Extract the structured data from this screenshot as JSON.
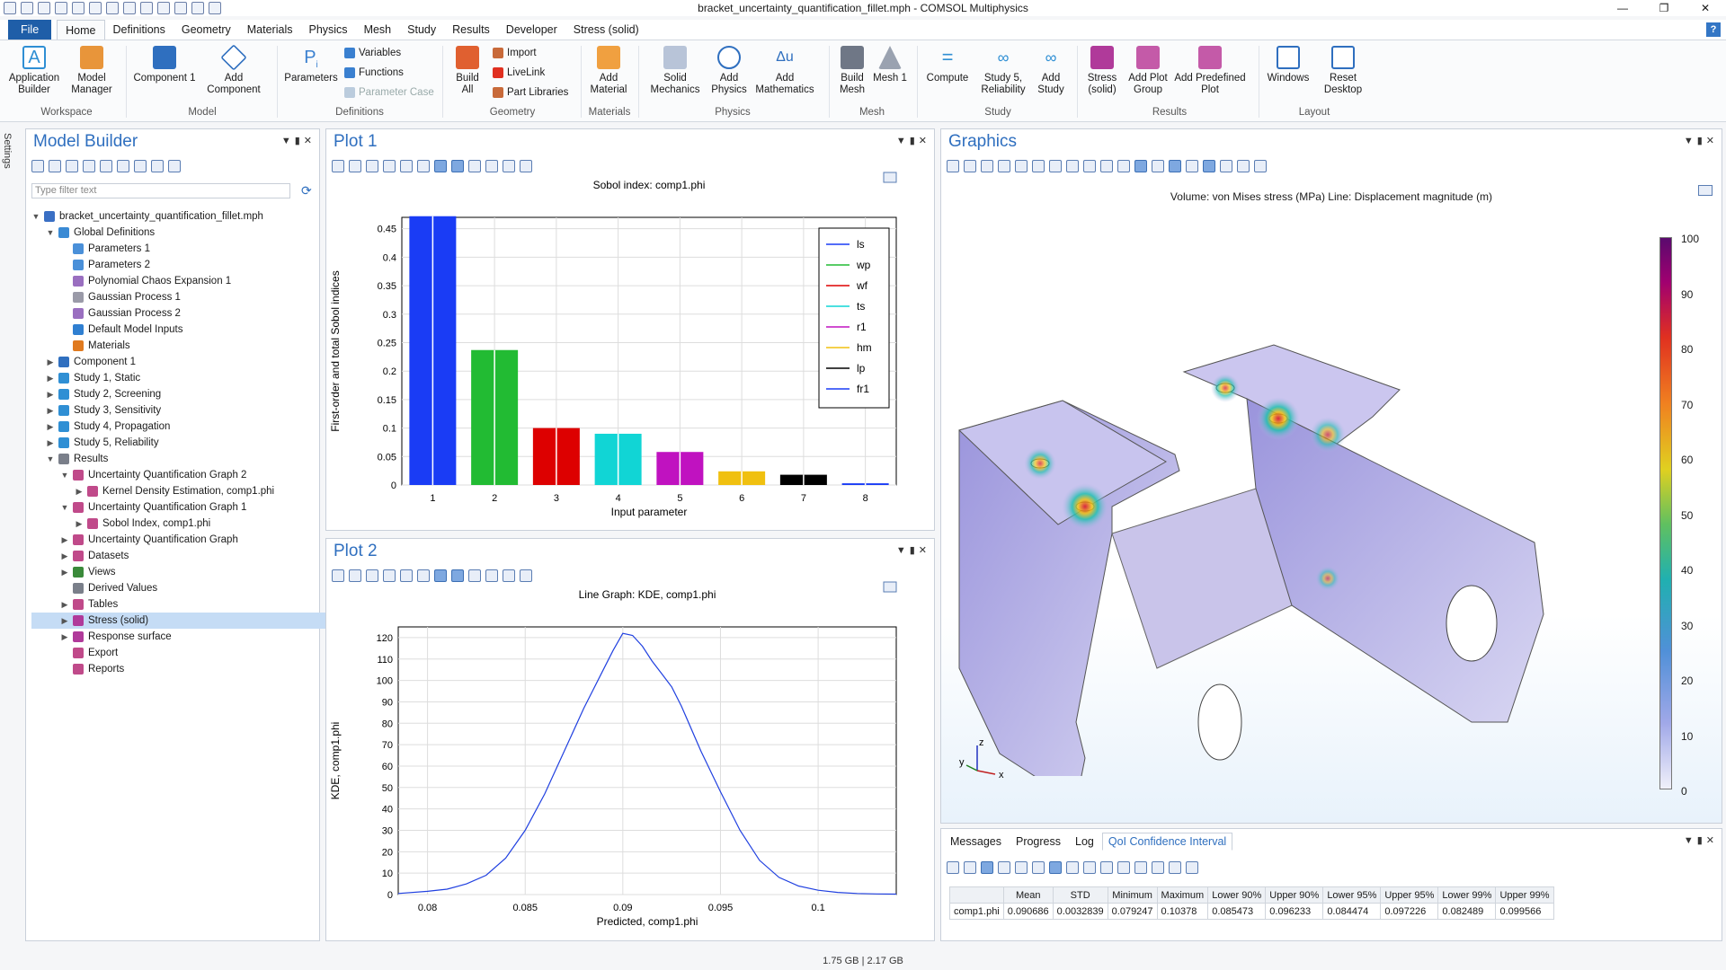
{
  "window": {
    "title": "bracket_uncertainty_quantification_fillet.mph - COMSOL Multiphysics"
  },
  "menu": {
    "file": "File",
    "items": [
      "Home",
      "Definitions",
      "Geometry",
      "Materials",
      "Physics",
      "Mesh",
      "Study",
      "Results",
      "Developer",
      "Stress (solid)"
    ]
  },
  "ribbon": {
    "buttons": {
      "app_builder": "Application Builder",
      "model_manager": "Model Manager",
      "component": "Component 1",
      "add_component": "Add Component",
      "parameters": "Parameters",
      "variables": "Variables",
      "functions": "Functions",
      "parameter_case": "Parameter Case",
      "build_all": "Build All",
      "import": "Import",
      "livelink": "LiveLink",
      "part_libraries": "Part Libraries",
      "add_material": "Add Material",
      "solid_mechanics": "Solid Mechanics",
      "add_physics": "Add Physics",
      "add_mathematics": "Add Mathematics",
      "build_mesh": "Build Mesh",
      "mesh": "Mesh 1",
      "compute": "Compute",
      "study5": "Study 5, Reliability",
      "add_study": "Add Study",
      "stress": "Stress (solid)",
      "add_plot_group": "Add Plot Group",
      "add_predefined_plot": "Add Predefined Plot",
      "windows": "Windows",
      "reset_desktop": "Reset Desktop"
    },
    "groups": {
      "workspace": "Workspace",
      "model": "Model",
      "definitions": "Definitions",
      "geometry": "Geometry",
      "materials": "Materials",
      "physics": "Physics",
      "mesh": "Mesh",
      "study": "Study",
      "results": "Results",
      "layout": "Layout"
    }
  },
  "settings_tab": "Settings",
  "model_builder": {
    "title": "Model Builder",
    "filter_placeholder": "Type filter text",
    "tree": [
      {
        "label": "bracket_uncertainty_quantification_fillet.mph",
        "icon": "file-icon",
        "color": "#3a6fc4"
      },
      {
        "label": "Global Definitions",
        "icon": "globe-icon",
        "color": "#3a8ad4"
      },
      {
        "label": "Parameters 1",
        "icon": "parameter-icon",
        "color": "#4a90d9"
      },
      {
        "label": "Parameters 2",
        "icon": "parameter-icon",
        "color": "#4a90d9"
      },
      {
        "label": "Polynomial Chaos Expansion 1",
        "icon": "surrogate-icon",
        "color": "#9a6fc0"
      },
      {
        "label": "Gaussian Process 1",
        "icon": "surrogate-icon",
        "color": "#9a9aa8"
      },
      {
        "label": "Gaussian Process 2",
        "icon": "surrogate-icon",
        "color": "#9a6fc0"
      },
      {
        "label": "Default Model Inputs",
        "icon": "model-inputs-icon",
        "color": "#2f7fd1"
      },
      {
        "label": "Materials",
        "icon": "materials-icon",
        "color": "#e07a1f"
      },
      {
        "label": "Component 1",
        "icon": "component-icon",
        "color": "#2f6fbf"
      },
      {
        "label": "Study 1, Static",
        "icon": "study-icon",
        "color": "#2f8fd4"
      },
      {
        "label": "Study 2, Screening",
        "icon": "study-icon",
        "color": "#2f8fd4"
      },
      {
        "label": "Study 3, Sensitivity",
        "icon": "study-icon",
        "color": "#2f8fd4"
      },
      {
        "label": "Study 4, Propagation",
        "icon": "study-icon",
        "color": "#2f8fd4"
      },
      {
        "label": "Study 5, Reliability",
        "icon": "study-icon",
        "color": "#2f8fd4"
      },
      {
        "label": "Results",
        "icon": "results-icon",
        "color": "#7a7f8a"
      },
      {
        "label": "Uncertainty Quantification Graph 2",
        "icon": "graph-icon",
        "color": "#c04a8a"
      },
      {
        "label": "Kernel Density Estimation, comp1.phi",
        "icon": "line-graph-icon",
        "color": "#c04a8a"
      },
      {
        "label": "Uncertainty Quantification Graph 1",
        "icon": "graph-icon",
        "color": "#c04a8a"
      },
      {
        "label": "Sobol Index, comp1.phi",
        "icon": "line-graph-icon",
        "color": "#c04a8a"
      },
      {
        "label": "Uncertainty Quantification Graph",
        "icon": "graph-icon",
        "color": "#c04a8a"
      },
      {
        "label": "Datasets",
        "icon": "datasets-icon",
        "color": "#c04a8a"
      },
      {
        "label": "Views",
        "icon": "views-icon",
        "color": "#3a8a3a"
      },
      {
        "label": "Derived Values",
        "icon": "derived-values-icon",
        "color": "#7a7f8a"
      },
      {
        "label": "Tables",
        "icon": "table-icon",
        "color": "#c04a8a"
      },
      {
        "label": "Stress (solid)",
        "icon": "plot-group-icon",
        "color": "#b03a9a"
      },
      {
        "label": "Response surface",
        "icon": "plot-group-icon",
        "color": "#b03a9a"
      },
      {
        "label": "Export",
        "icon": "export-icon",
        "color": "#c04a8a"
      },
      {
        "label": "Reports",
        "icon": "reports-icon",
        "color": "#c04a8a"
      }
    ]
  },
  "plot1": {
    "panel_title": "Plot 1"
  },
  "plot2": {
    "panel_title": "Plot 2"
  },
  "chart_data": [
    {
      "type": "bar",
      "title": "Sobol index: comp1.phi",
      "xlabel": "Input parameter",
      "ylabel": "First-order and total Sobol indices",
      "categories": [
        "1",
        "2",
        "3",
        "4",
        "5",
        "6",
        "7",
        "8"
      ],
      "values": [
        0.472,
        0.237,
        0.1,
        0.09,
        0.058,
        0.024,
        0.018,
        0.003
      ],
      "colors": [
        "#1a3cf5",
        "#22bb33",
        "#dd0000",
        "#11d5d5",
        "#c012c0",
        "#f0c010",
        "#000000",
        "#1a3cf5"
      ],
      "ylim": [
        0,
        0.47
      ],
      "yticks": [
        "0",
        "0.05",
        "0.1",
        "0.15",
        "0.2",
        "0.25",
        "0.3",
        "0.35",
        "0.4",
        "0.45"
      ],
      "legend": {
        "placement": "top-right",
        "entries": [
          {
            "name": "ls",
            "color": "#1a3cf5"
          },
          {
            "name": "wp",
            "color": "#22bb33"
          },
          {
            "name": "wf",
            "color": "#dd0000"
          },
          {
            "name": "ts",
            "color": "#11d5d5"
          },
          {
            "name": "r1",
            "color": "#c012c0"
          },
          {
            "name": "hm",
            "color": "#f0c010"
          },
          {
            "name": "lp",
            "color": "#000000"
          },
          {
            "name": "fr1",
            "color": "#1a3cf5"
          }
        ]
      },
      "grid": true
    },
    {
      "type": "line",
      "title": "Line Graph: KDE, comp1.phi",
      "xlabel": "Predicted, comp1.phi",
      "ylabel": "KDE, comp1.phi",
      "xlim": [
        0.0785,
        0.104
      ],
      "ylim": [
        0,
        125
      ],
      "xticks": [
        "0.08",
        "0.085",
        "0.09",
        "0.095",
        "0.1"
      ],
      "yticks": [
        "0",
        "10",
        "20",
        "30",
        "40",
        "50",
        "60",
        "70",
        "80",
        "90",
        "100",
        "110",
        "120"
      ],
      "series": [
        {
          "color": "#2040e0",
          "x": [
            0.0785,
            0.08,
            0.081,
            0.082,
            0.083,
            0.084,
            0.085,
            0.086,
            0.087,
            0.088,
            0.089,
            0.0895,
            0.09,
            0.0905,
            0.091,
            0.0915,
            0.092,
            0.0925,
            0.093,
            0.094,
            0.095,
            0.096,
            0.097,
            0.098,
            0.099,
            0.1,
            0.101,
            0.102,
            0.103,
            0.104
          ],
          "y": [
            0.5,
            1.5,
            2.5,
            5,
            9,
            17,
            30,
            47,
            67,
            87,
            105,
            114,
            122,
            121,
            116,
            109,
            103,
            97,
            88,
            67,
            48,
            30,
            16,
            8,
            4,
            2,
            1,
            0.5,
            0.3,
            0.2
          ]
        }
      ],
      "grid": true
    }
  ],
  "graphics": {
    "panel_title": "Graphics",
    "subtitle": "Volume: von Mises stress (MPa)  Line: Displacement magnitude (m)",
    "colorbar": {
      "labels": [
        "100",
        "90",
        "80",
        "70",
        "60",
        "50",
        "40",
        "30",
        "20",
        "10",
        "0"
      ]
    },
    "axes": {
      "z": "z",
      "y": "y",
      "x": "x"
    }
  },
  "messages": {
    "tabs": [
      "Messages",
      "Progress",
      "Log",
      "QoI Confidence Interval"
    ],
    "table": {
      "headers": [
        "",
        "Mean",
        "STD",
        "Minimum",
        "Maximum",
        "Lower 90%",
        "Upper 90%",
        "Lower 95%",
        "Upper 95%",
        "Lower 99%",
        "Upper 99%"
      ],
      "rows": [
        [
          "comp1.phi",
          "0.090686",
          "0.0032839",
          "0.079247",
          "0.10378",
          "0.085473",
          "0.096233",
          "0.084474",
          "0.097226",
          "0.082489",
          "0.099566"
        ]
      ]
    }
  },
  "status": {
    "memory": "1.75 GB | 2.17 GB"
  }
}
